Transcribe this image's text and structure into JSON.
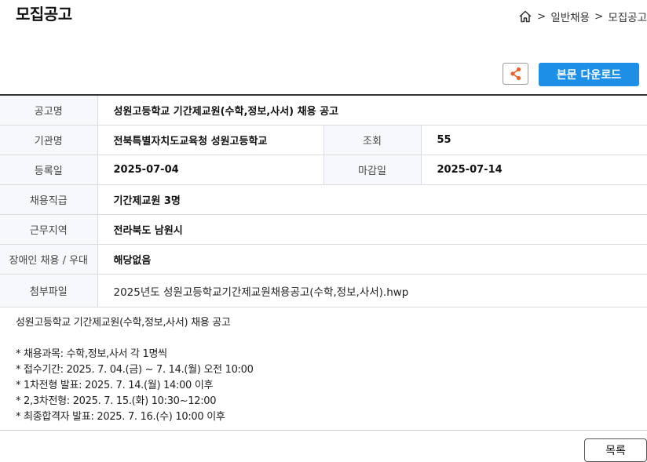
{
  "page_title": "모집공고",
  "breadcrumb": {
    "sep": ">",
    "items": [
      "일반채용",
      "모집공고"
    ]
  },
  "actions": {
    "download_label": "본문 다운로드"
  },
  "info": {
    "title_label": "공고명",
    "title_value": "성원고등학교 기간제교원(수학,정보,사서) 채용 공고",
    "org_label": "기관명",
    "org_value": "전북특별자치도교육청 성원고등학교",
    "views_label": "조회",
    "views_value": "55",
    "reg_label": "등록일",
    "reg_value": "2025-07-04",
    "deadline_label": "마감일",
    "deadline_value": "2025-07-14",
    "position_label": "채용직급",
    "position_value": "기간제교원 3명",
    "region_label": "근무지역",
    "region_value": "전라북도 남원시",
    "disabled_label": "장애인 채용 / 우대",
    "disabled_value": "해당없음",
    "attach_label": "첨부파일",
    "attach_value": "2025년도 성원고등학교기간제교원채용공고(수학,정보,사서).hwp"
  },
  "body": {
    "heading": "성원고등학교 기간제교원(수학,정보,사서) 채용 공고",
    "lines": [
      "* 채용과목: 수학,정보,사서 각 1명씩",
      "* 접수기간: 2025. 7. 04.(금) ~ 7. 14.(월) 오전 10:00",
      "* 1차전형 발표: 2025. 7. 14.(월) 14:00 이후",
      "* 2,3차전형: 2025. 7. 15.(화) 10:30~12:00",
      "* 최종합격자 발표: 2025. 7. 16.(수) 10:00 이후"
    ]
  },
  "list_button": "목록",
  "colors": {
    "accent": "#1e8fe6",
    "share_icon": "#e8642c",
    "label_bg": "#f6f8fb"
  }
}
